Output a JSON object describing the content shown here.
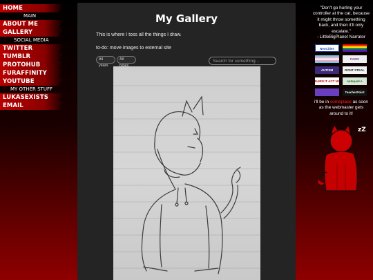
{
  "nav": {
    "home": "HOME",
    "main": "MAIN",
    "about": "ABOUT ME",
    "gallery": "GALLERY",
    "social_media": "SOCIAL MEDIA",
    "twitter": "TWITTER",
    "tumblr": "TUMBLR",
    "protohub": "PROTOHUB",
    "furaffinity": "FURAFFINITY",
    "youtube": "YOUTUBE",
    "other_stuff": "MY OTHER STUFF",
    "lukasexists": "LUKASEXISTS",
    "email": "EMAIL"
  },
  "main": {
    "title": "My Gallery",
    "intro": "This is where I toss all the things I draw.",
    "todo": "to-do: move images to external site",
    "filter_years": "All years",
    "filter_types": "All types",
    "search_placeholder": "Search for something..."
  },
  "sidebar": {
    "quote": "\"Don't go hurling your controller at the cat, because it might throw something back, and then it'll only escalate.\"",
    "quote_author": "- LittleBigPlanet Narrator",
    "note_pre": "i'll be in",
    "note_hl": "someplace",
    "note_post": "as soon as the webmaster gets around to it!",
    "sleep": "zZ",
    "badges": [
      {
        "name": "neocities",
        "text": "NeoCities",
        "bg": "#ffffff",
        "fg": "#1a3fa8"
      },
      {
        "name": "pride",
        "text": "",
        "bg": "#e40303",
        "fg": "#fff"
      },
      {
        "name": "trans",
        "text": "",
        "bg": "#5bcefa",
        "fg": "#fff"
      },
      {
        "name": "paw",
        "text": "PAWS",
        "bg": "#f0f0f0",
        "fg": "#7a3fa0"
      },
      {
        "name": "autism",
        "text": "AUTISM",
        "bg": "#3b2a7a",
        "fg": "#fff"
      },
      {
        "name": "dont-steal",
        "text": "DONT STEAL",
        "bg": "#f4f4f4",
        "fg": "#222"
      },
      {
        "name": "earn-it",
        "text": "EARN IT ACT NO",
        "bg": "#ffffff",
        "fg": "#c00000"
      },
      {
        "name": "notepad",
        "text": "notepad++",
        "bg": "#d8e8d8",
        "fg": "#2a6a2a"
      },
      {
        "name": "pixel",
        "text": "",
        "bg": "#6a3fbf",
        "fg": "#fff"
      },
      {
        "name": "teacherpoint",
        "text": "TeacherPoint",
        "bg": "#111111",
        "fg": "#fff"
      }
    ]
  },
  "colors": {
    "accent": "#b80000",
    "panel": "#242424"
  }
}
